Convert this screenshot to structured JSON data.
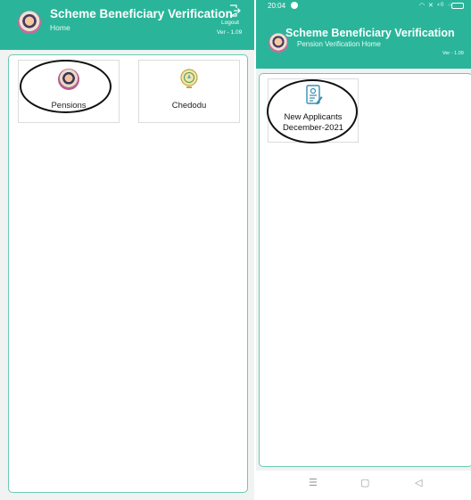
{
  "left": {
    "header": {
      "title": "Scheme Beneficiary Verification",
      "subtitle": "Home",
      "logout_label": "Logout",
      "version": "Ver - 1.09"
    },
    "tiles": [
      {
        "label": "Pensions",
        "icon": "pensions-logo-icon"
      },
      {
        "label": "Chedodu",
        "icon": "state-emblem-icon"
      }
    ]
  },
  "right": {
    "status_bar": {
      "time": "20:04",
      "icons": "◠ ✕ ⁴ᴳ ⁘"
    },
    "header": {
      "title": "Scheme Beneficiary Verification",
      "subtitle": "Pension Verification Home",
      "version": "Ver - 1.09"
    },
    "tiles": [
      {
        "label_line1": "New Applicants",
        "label_line2": "December-2021",
        "icon": "document-check-icon"
      }
    ],
    "nav": {
      "menu": "☰",
      "home": "▢",
      "back": "◁"
    }
  },
  "colors": {
    "header": "#2ab59a",
    "panel_border": "#6cc9b4",
    "annotation": "#111111"
  }
}
